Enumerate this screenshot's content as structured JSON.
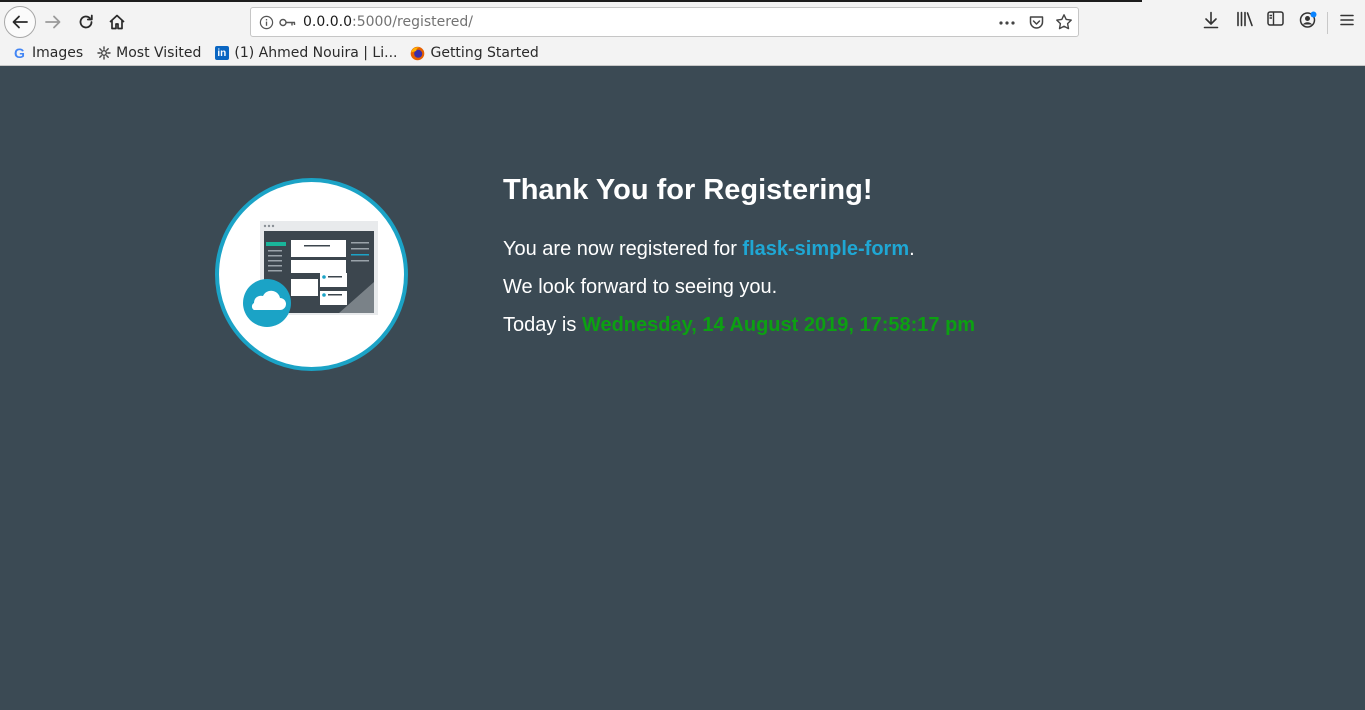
{
  "browser": {
    "url_host": "0.0.0.0",
    "url_path": ":5000/registered/",
    "bookmarks": [
      {
        "label": "Images",
        "icon": "google-icon"
      },
      {
        "label": "Most Visited",
        "icon": "gear-icon"
      },
      {
        "label": "(1) Ahmed Nouira | Li...",
        "icon": "linkedin-icon"
      },
      {
        "label": "Getting Started",
        "icon": "firefox-icon"
      }
    ]
  },
  "page": {
    "heading": "Thank You for Registering!",
    "line1_prefix": "You are now registered for ",
    "app_name": "flask-simple-form",
    "line1_suffix": ".",
    "line2": "We look forward to seeing you.",
    "line3_prefix": "Today is ",
    "date": "Wednesday, 14 August 2019, 17:58:17 pm"
  },
  "colors": {
    "background": "#3b4a54",
    "accent_blue": "#1fa7d4",
    "date_green": "#0ca012",
    "circle_border": "#1ba3c6"
  }
}
